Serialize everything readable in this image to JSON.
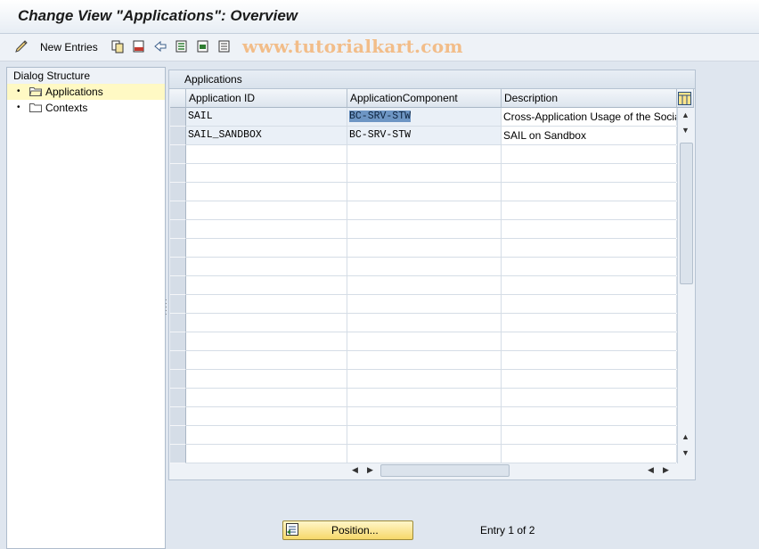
{
  "title": "Change View \"Applications\": Overview",
  "toolbar": {
    "new_entries_label": "New Entries"
  },
  "watermark": "www.tutorialkart.com",
  "dialog_structure": {
    "header": "Dialog Structure",
    "items": [
      {
        "label": "Applications",
        "selected": true,
        "icon": "folder-open-icon"
      },
      {
        "label": "Contexts",
        "selected": false,
        "icon": "folder-icon"
      }
    ]
  },
  "table": {
    "title": "Applications",
    "columns": [
      "Application ID",
      "ApplicationComponent",
      "Description"
    ],
    "rows": [
      [
        "SAIL",
        "BC-SRV-STW",
        "Cross-Application Usage of the Social"
      ],
      [
        "SAIL_SANDBOX",
        "BC-SRV-STW",
        "SAIL on Sandbox"
      ]
    ]
  },
  "footer": {
    "position_label": "Position...",
    "entry_text": "Entry 1 of 2"
  },
  "colors": {
    "accent": "#6e96c4",
    "selected_row": "#fff9c4",
    "button": "#f6d86a"
  }
}
